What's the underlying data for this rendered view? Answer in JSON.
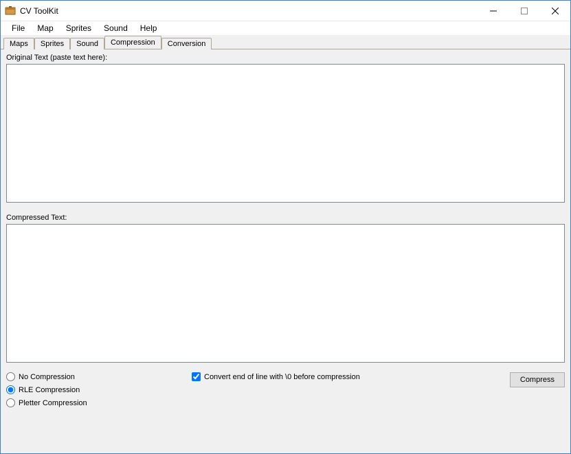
{
  "window": {
    "title": "CV ToolKit"
  },
  "menu": {
    "items": [
      "File",
      "Map",
      "Sprites",
      "Sound",
      "Help"
    ]
  },
  "tabs": {
    "items": [
      "Maps",
      "Sprites",
      "Sound",
      "Compression",
      "Conversion"
    ],
    "activeIndex": 3
  },
  "labels": {
    "original": "Original Text (paste text here):",
    "compressed": "Compressed Text:"
  },
  "fields": {
    "original_value": "",
    "compressed_value": ""
  },
  "radios": {
    "none": "No Compression",
    "rle": "RLE Compression",
    "pletter": "Pletter Compression",
    "selected": "rle"
  },
  "checkbox": {
    "convert_label": "Convert end of line with \\0 before compression",
    "checked": true
  },
  "buttons": {
    "compress": "Compress"
  }
}
